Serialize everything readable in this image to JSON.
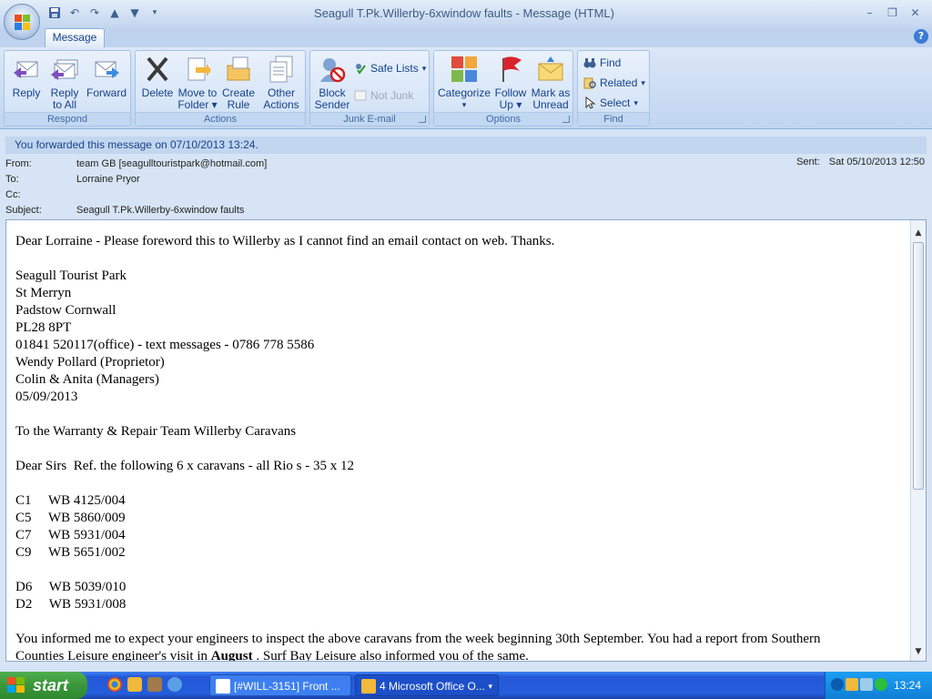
{
  "window": {
    "title": "Seagull T.Pk.Willerby-6xwindow faults - Message (HTML)",
    "tab": "Message"
  },
  "ribbon": {
    "respond": {
      "label": "Respond",
      "reply": "Reply",
      "reply_all_1": "Reply",
      "reply_all_2": "to All",
      "forward": "Forward"
    },
    "actions": {
      "label": "Actions",
      "delete": "Delete",
      "move_1": "Move to",
      "move_2": "Folder",
      "create_1": "Create",
      "create_2": "Rule",
      "other_1": "Other",
      "other_2": "Actions"
    },
    "junk": {
      "label": "Junk E-mail",
      "block_1": "Block",
      "block_2": "Sender",
      "safe_lists": "Safe Lists",
      "not_junk": "Not Junk"
    },
    "options": {
      "label": "Options",
      "categorize": "Categorize",
      "follow_1": "Follow",
      "follow_2": "Up",
      "mark_1": "Mark as",
      "mark_2": "Unread"
    },
    "find": {
      "label": "Find",
      "find": "Find",
      "related": "Related",
      "select": "Select"
    }
  },
  "infobar": "You forwarded this message on 07/10/2013 13:24.",
  "header": {
    "from_label": "From:",
    "from": "team GB [seagulltouristpark@hotmail.com]",
    "to_label": "To:",
    "to": "Lorraine Pryor",
    "cc_label": "Cc:",
    "cc": "",
    "subject_label": "Subject:",
    "subject": "Seagull T.Pk.Willerby-6xwindow faults",
    "sent_label": "Sent:",
    "sent": "Sat 05/10/2013 12:50"
  },
  "body": {
    "l1": "Dear Lorraine - Please foreword this to Willerby as I cannot find an email contact on web. Thanks.",
    "l2": "Seagull Tourist Park",
    "l3": "St Merryn",
    "l4": "Padstow Cornwall",
    "l5": "PL28 8PT",
    "l6": "01841 520117(office) - text messages - 0786 778 5586",
    "l7": "Wendy Pollard (Proprietor)",
    "l8": "Colin & Anita (Managers)",
    "l9": "05/09/2013",
    "l10": "To the Warranty & Repair Team Willerby Caravans",
    "l11": "Dear Sirs  Ref. the following 6 x caravans - all Rio s - 35 x 12",
    "c1": "C1     WB 4125/004",
    "c5": "C5     WB 5860/009",
    "c7": "C7     WB 5931/004",
    "c9": "C9     WB 5651/002",
    "d6": "D6     WB 5039/010",
    "d2": "D2     WB 5931/008",
    "p1": "You informed me to expect your engineers to inspect the above caravans from the week beginning 30th September. You had a report from Southern",
    "p2a": "Counties Leisure engineer's visit in ",
    "p2b": "August",
    "p2c": " . Surf Bay Leisure also informed you of the same."
  },
  "taskbar": {
    "start": "start",
    "task1": "[#WILL-3151] Front ...",
    "task2": "4 Microsoft Office O...",
    "clock": "13:24"
  }
}
